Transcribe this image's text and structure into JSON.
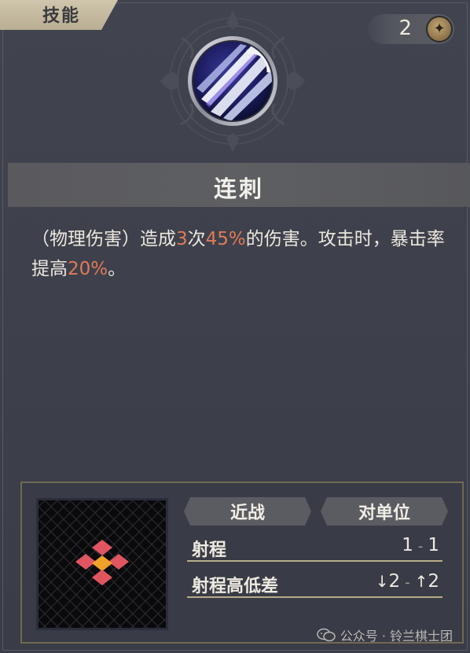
{
  "tab": {
    "label": "技能"
  },
  "counter": {
    "value": "2",
    "icon": "star-icon"
  },
  "skill": {
    "emblem_icon": "slash-sphere-icon",
    "title": "连刺",
    "description": {
      "part1": "（物理伤害）造成",
      "hits": "3",
      "part2": "次",
      "damage_pct": "45%",
      "part3": "的伤害。攻击时，暴击率提高",
      "crit_pct": "20%",
      "part4": "。"
    },
    "highlight_color": "#e07a55"
  },
  "info": {
    "tag_attack_type": "近战",
    "tag_target": "对单位",
    "range_label": "射程",
    "range_min": "1",
    "range_max": "1",
    "height_label": "射程高低差",
    "height_down": "2",
    "height_up": "2",
    "dash": "-",
    "pattern_icon": "range-pattern-icon"
  },
  "watermark": {
    "text": "公众号 · 铃兰棋士团",
    "icon": "wechat-icon"
  }
}
